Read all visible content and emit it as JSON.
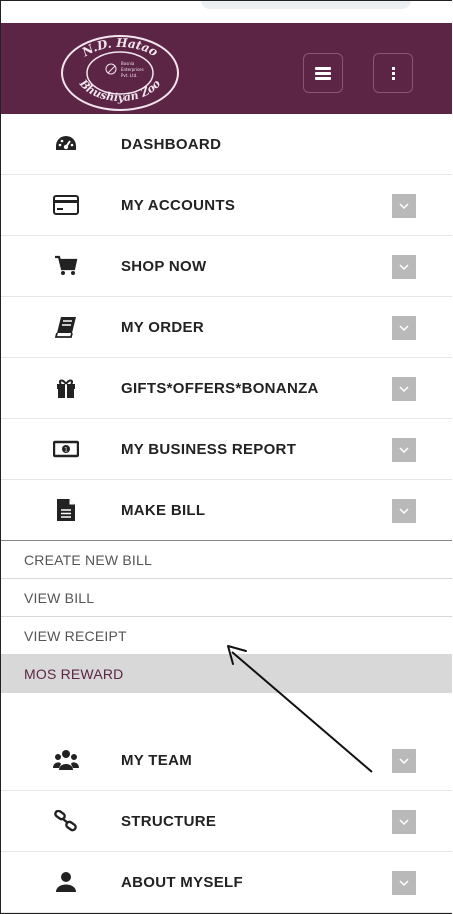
{
  "header": {
    "logo_text_top": "N.D. Hatao",
    "logo_text_bottom": "Bhushiyan Zoo",
    "logo_inner_text": "Bosnia Enterprises Pvt. Ltd.",
    "accent_color": "#5c2545"
  },
  "menu": [
    {
      "label": "DASHBOARD",
      "icon": "dashboard-gauge-icon",
      "has_dropdown": false
    },
    {
      "label": "MY ACCOUNTS",
      "icon": "credit-card-icon",
      "has_dropdown": true
    },
    {
      "label": "SHOP NOW",
      "icon": "shopping-cart-icon",
      "has_dropdown": true
    },
    {
      "label": "MY ORDER",
      "icon": "book-icon",
      "has_dropdown": true
    },
    {
      "label": "GIFTS*OFFERS*BONANZA",
      "icon": "gift-icon",
      "has_dropdown": true
    },
    {
      "label": "MY BUSINESS REPORT",
      "icon": "money-icon",
      "has_dropdown": true
    },
    {
      "label": "MAKE BILL",
      "icon": "file-icon",
      "has_dropdown": true,
      "submenu": [
        {
          "label": "CREATE NEW BILL",
          "active": false
        },
        {
          "label": "VIEW BILL",
          "active": false
        },
        {
          "label": "VIEW RECEIPT",
          "active": false
        },
        {
          "label": "MOS REWARD",
          "active": true
        }
      ]
    },
    {
      "label": "MY TEAM",
      "icon": "users-icon",
      "has_dropdown": true
    },
    {
      "label": "STRUCTURE",
      "icon": "link-icon",
      "has_dropdown": true
    },
    {
      "label": "ABOUT MYSELF",
      "icon": "user-icon",
      "has_dropdown": true
    }
  ]
}
